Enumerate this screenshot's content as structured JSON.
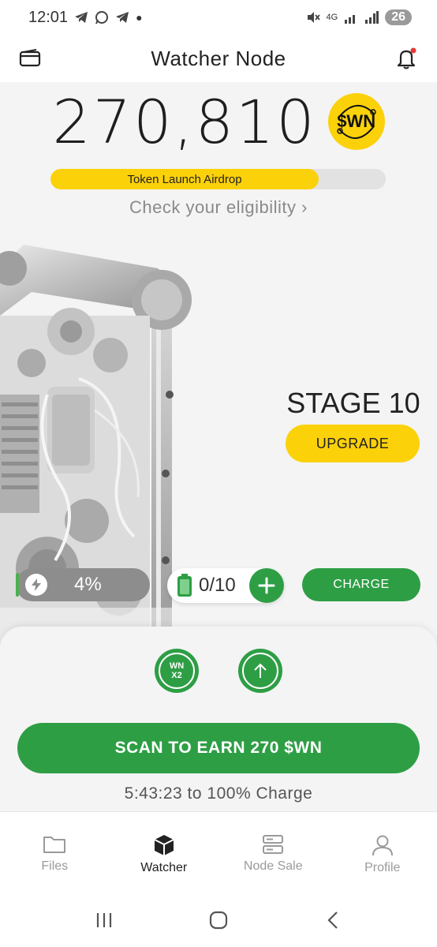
{
  "status_bar": {
    "time": "12:01",
    "battery": "26",
    "network": "4G"
  },
  "header": {
    "title": "Watcher Node"
  },
  "balance": {
    "amount": "270,810",
    "token": "$WN"
  },
  "airdrop": {
    "label": "Token Launch Airdrop",
    "progress": 0.8,
    "link": "Check your eligibility ›"
  },
  "stage": {
    "label": "STAGE 10",
    "upgrade_label": "UPGRADE"
  },
  "energy": {
    "percent_label": "4%",
    "batteries_label": "0/10",
    "charge_label": "CHARGE"
  },
  "actions": {
    "boost_label_1": "WN",
    "boost_label_2": "X2",
    "scan_label": "SCAN TO EARN 270 $WN",
    "charge_time": "5:43:23 to 100% Charge"
  },
  "nav": {
    "items": [
      {
        "label": "Files",
        "icon": "folder-icon"
      },
      {
        "label": "Watcher",
        "icon": "cube-icon"
      },
      {
        "label": "Node Sale",
        "icon": "server-icon"
      },
      {
        "label": "Profile",
        "icon": "user-icon"
      }
    ],
    "active": "Watcher"
  },
  "colors": {
    "accent_yellow": "#fbd10a",
    "accent_green": "#2e9e45"
  }
}
